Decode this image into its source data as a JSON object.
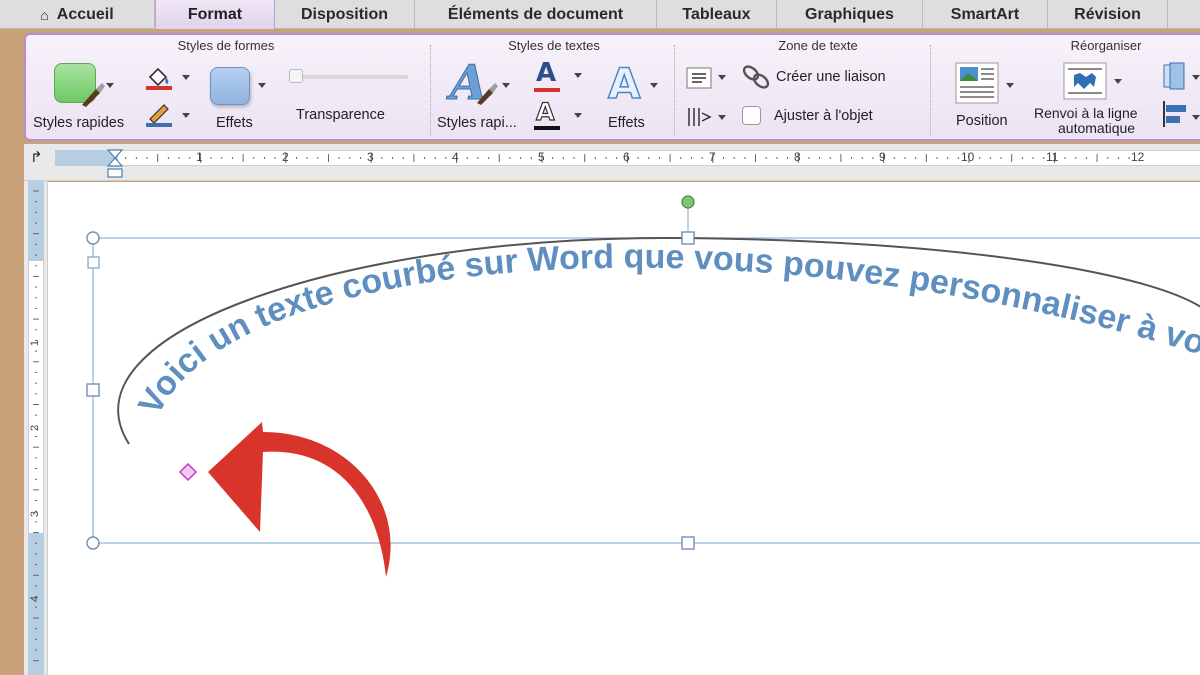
{
  "tabs": [
    {
      "label": "Accueil",
      "active": false
    },
    {
      "label": "Format",
      "active": true
    },
    {
      "label": "Disposition",
      "active": false
    },
    {
      "label": "Éléments de document",
      "active": false
    },
    {
      "label": "Tableaux",
      "active": false
    },
    {
      "label": "Graphiques",
      "active": false
    },
    {
      "label": "SmartArt",
      "active": false
    },
    {
      "label": "Révision",
      "active": false
    }
  ],
  "ribbon": {
    "groups": {
      "shape_styles": "Styles de formes",
      "text_styles": "Styles de textes",
      "text_box": "Zone de texte",
      "arrange": "Réorganiser"
    },
    "quick_styles": "Styles rapides",
    "effects": "Effets",
    "transparency": "Transparence",
    "text_quick_styles": "Styles rapi...",
    "text_effects": "Effets",
    "create_link": "Créer une liaison",
    "fit_to_object": "Ajuster à l'objet",
    "position": "Position",
    "wrap_line1": "Renvoi à la ligne",
    "wrap_line2": "automatique"
  },
  "ruler_numbers": [
    "1",
    "2",
    "3",
    "4",
    "5",
    "6",
    "7",
    "8",
    "9",
    "10",
    "11",
    "12"
  ],
  "vruler_numbers": [
    "1",
    "2",
    "3",
    "4"
  ],
  "curved_text": "Voici un texte courbé sur Word que vous pouvez personnaliser à volonté",
  "colors": {
    "curved_text": "#5e8fc0",
    "arrow": "#d9342b",
    "ribbon_accent": "#b58fd3",
    "selection": "#8aa9d6"
  }
}
